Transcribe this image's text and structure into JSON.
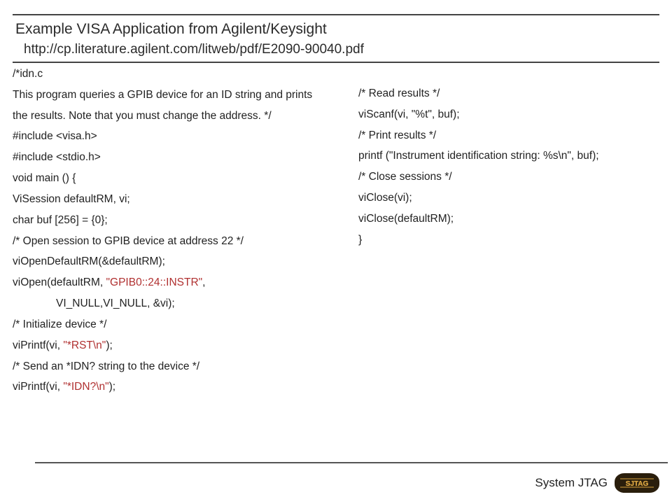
{
  "header": {
    "title": "Example VISA Application from Agilent/Keysight",
    "subtitle": "http://cp.literature.agilent.com/litweb/pdf/E2090-90040.pdf"
  },
  "left": [
    {
      "t": "/*idn.c"
    },
    {
      "t": "This program queries a GPIB device for an ID string and prints",
      "wrap": true
    },
    {
      "t": "the results. Note that you must change the address. */"
    },
    {
      "t": "#include <visa.h>"
    },
    {
      "t": "#include <stdio.h>"
    },
    {
      "t": "void main () {"
    },
    {
      "t": "ViSession defaultRM, vi;"
    },
    {
      "t": "char buf [256] = {0};"
    },
    {
      "t": "/* Open session to GPIB device at address 22 */"
    },
    {
      "t": "viOpenDefaultRM(&defaultRM);"
    },
    {
      "pre": "viOpen(defaultRM, ",
      "red": "\"GPIB0::24::INSTR\"",
      "post": ","
    },
    {
      "t": "VI_NULL,VI_NULL, &vi);",
      "indent": true
    },
    {
      "t": "/* Initialize device */"
    },
    {
      "pre": "viPrintf(vi, ",
      "red": "\"*RST\\n\"",
      "post": ");"
    },
    {
      "t": "/* Send an *IDN? string to the device */"
    },
    {
      "pre": "viPrintf(vi, ",
      "red": "\"*IDN?\\n\"",
      "post": ");"
    }
  ],
  "right": [
    {
      "t": "/* Read results */"
    },
    {
      "t": "viScanf(vi, \"%t\", buf);"
    },
    {
      "t": "/* Print results */"
    },
    {
      "t": "printf (\"Instrument identification string: %s\\n\", buf);"
    },
    {
      "t": "/* Close sessions */"
    },
    {
      "t": "viClose(vi);"
    },
    {
      "t": "viClose(defaultRM);"
    },
    {
      "t": "}"
    }
  ],
  "footer": {
    "label": "System JTAG",
    "logo_text": "SJTAG"
  }
}
